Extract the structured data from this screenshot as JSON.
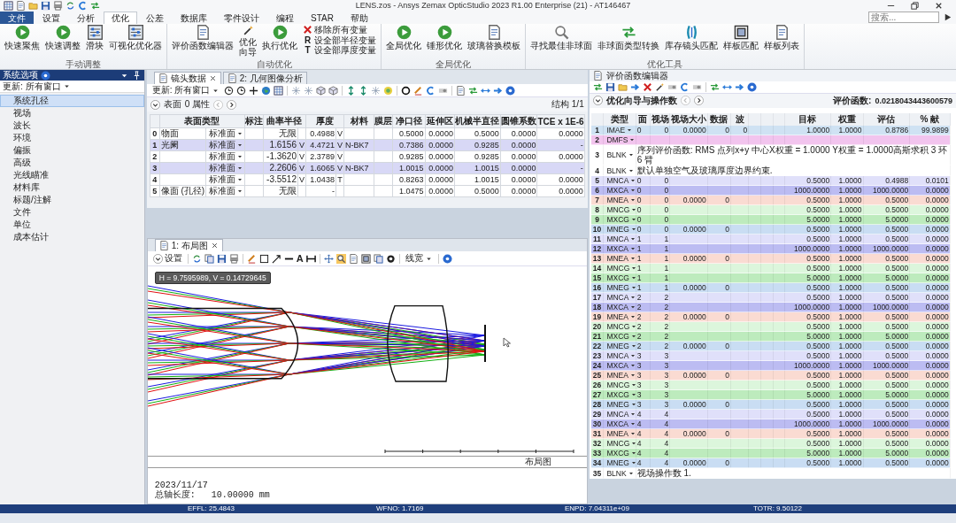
{
  "window": {
    "title": "LENS.zos - Ansys Zemax OpticStudio 2023 R1.00   Enterprise (21) - AT146467"
  },
  "menu_tabs": [
    {
      "label": "文件",
      "kind": "file",
      "selected": false
    },
    {
      "label": "设置",
      "kind": "tab",
      "selected": false
    },
    {
      "label": "分析",
      "kind": "tab",
      "selected": false
    },
    {
      "label": "优化",
      "kind": "tab",
      "selected": true
    },
    {
      "label": "公差",
      "kind": "tab",
      "selected": false
    },
    {
      "label": "数据库",
      "kind": "tab",
      "selected": false
    },
    {
      "label": "零件设计",
      "kind": "tab",
      "selected": false
    },
    {
      "label": "编程",
      "kind": "tab",
      "selected": false
    },
    {
      "label": "STAR",
      "kind": "tab",
      "selected": false
    },
    {
      "label": "帮助",
      "kind": "tab",
      "selected": false
    }
  ],
  "search": {
    "placeholder": "搜索..."
  },
  "ribbon": [
    {
      "label": "手动调整",
      "buttons": [
        {
          "label": "快速聚焦",
          "kind": "large"
        },
        {
          "label": "快速调整",
          "kind": "large"
        },
        {
          "label": "滑块",
          "kind": "large"
        },
        {
          "label": "可视化优化器",
          "kind": "large"
        }
      ]
    },
    {
      "label": "自动优化",
      "buttons": [
        {
          "label": "评价函数编辑器",
          "kind": "large"
        },
        {
          "label": "优化向导",
          "kind": "narrow"
        },
        {
          "label": "执行优化",
          "kind": "large"
        }
      ],
      "small_buttons": [
        {
          "label": "移除所有变量"
        },
        {
          "label": "设全部半径变量",
          "glyph": "R"
        },
        {
          "label": "设全部厚度变量",
          "glyph": "T"
        }
      ]
    },
    {
      "label": "全局优化",
      "buttons": [
        {
          "label": "全局优化",
          "kind": "large"
        },
        {
          "label": "锤形优化",
          "kind": "large"
        },
        {
          "label": "玻璃替换模板",
          "kind": "large"
        }
      ]
    },
    {
      "label": "优化工具",
      "buttons": [
        {
          "label": "寻找最佳非球面",
          "kind": "large"
        },
        {
          "label": "非球面类型转换",
          "kind": "large"
        },
        {
          "label": "库存镜头匹配",
          "kind": "large"
        },
        {
          "label": "样板匹配",
          "kind": "large"
        },
        {
          "label": "样板列表",
          "kind": "large"
        }
      ]
    }
  ],
  "sidebar": {
    "title": "系统选项",
    "update": "更新: 所有窗口",
    "items": [
      {
        "label": "系统孔径",
        "selected": true
      },
      {
        "label": "视场",
        "selected": false
      },
      {
        "label": "波长",
        "selected": false
      },
      {
        "label": "环境",
        "selected": false
      },
      {
        "label": "偏振",
        "selected": false
      },
      {
        "label": "高级",
        "selected": false
      },
      {
        "label": "光线瞄准",
        "selected": false
      },
      {
        "label": "材料库",
        "selected": false
      },
      {
        "label": "标题/注解",
        "selected": false
      },
      {
        "label": "文件",
        "selected": false
      },
      {
        "label": "单位",
        "selected": false
      },
      {
        "label": "成本估计",
        "selected": false
      }
    ]
  },
  "lens_pane": {
    "tabs": [
      {
        "label": "镜头数据",
        "selected": true
      },
      {
        "label": "2: 几何图像分析",
        "selected": false
      }
    ],
    "update": "更新: 所有窗口",
    "surface_label": "表面",
    "surface_props": "0 属性",
    "config": "结构 1/1",
    "columns": [
      "表面类型",
      "标注",
      "曲率半径",
      "厚度",
      "材料",
      "膜层",
      "净口径",
      "延伸区",
      "机械半直径",
      "圆锥系数",
      "TCE x 1E-6"
    ],
    "rows": [
      {
        "num": "0",
        "comment": "物面",
        "type": "标准面",
        "radius": "无限",
        "thickness": "0.4988",
        "thickness_solve": "V",
        "clear": "0.5000",
        "chip": "0.0000",
        "mech": "0.5000",
        "conic": "0.0000",
        "tce": "0.0000",
        "color": "#ffffff"
      },
      {
        "num": "1",
        "comment": "光阑",
        "type": "标准面",
        "radius": "1.6156",
        "radius_solve": "V",
        "thickness": "4.4721",
        "thickness_solve": "V",
        "material": "N-BK7",
        "clear": "0.7386",
        "chip": "0.0000",
        "mech": "0.9285",
        "conic": "0.0000",
        "tce": "-",
        "color": "#d8d8f6"
      },
      {
        "num": "2",
        "type": "标准面",
        "radius": "-1.3620",
        "radius_solve": "V",
        "thickness": "2.3789",
        "thickness_solve": "V",
        "clear": "0.9285",
        "chip": "0.0000",
        "mech": "0.9285",
        "conic": "0.0000",
        "tce": "0.0000",
        "color": "#ffffff"
      },
      {
        "num": "3",
        "type": "标准面",
        "radius": "2.2606",
        "radius_solve": "V",
        "thickness": "1.6065",
        "thickness_solve": "V",
        "material": "N-BK7",
        "clear": "1.0015",
        "chip": "0.0000",
        "mech": "1.0015",
        "conic": "0.0000",
        "tce": "-",
        "color": "#d8d8f6"
      },
      {
        "num": "4",
        "type": "标准面",
        "radius": "-3.5512",
        "radius_solve": "V",
        "thickness": "1.0438",
        "thickness_solve": "T",
        "clear": "0.8263",
        "chip": "0.0000",
        "mech": "1.0015",
        "conic": "0.0000",
        "tce": "0.0000",
        "color": "#ffffff"
      },
      {
        "num": "5",
        "comment": "像面 (孔径)",
        "type": "标准面",
        "radius": "无限",
        "thickness": "-",
        "clear": "1.0475",
        "chip": "0.0000",
        "mech": "0.5000",
        "conic": "0.0000",
        "tce": "0.0000",
        "color": "#ffffff"
      }
    ]
  },
  "layout_pane": {
    "tab": {
      "label": "1: 布局图",
      "selected": true
    },
    "settings": "设置",
    "text_tool": "A",
    "line_width": "线宽",
    "tooltip": "H = 9.7595989, V = 0.14729645",
    "caption": "布局图",
    "footer": [
      "2023/11/17",
      "总轴长度:   10.00000 mm"
    ]
  },
  "merit_pane": {
    "title": "评价函数编辑器",
    "section": "优化向导与操作数",
    "merit_label": "评价函数:",
    "merit_value": "0.0218043443600579",
    "columns": [
      "类型",
      "面",
      "视场",
      "视场大小",
      "数据",
      "波",
      "目标",
      "权重",
      "评估",
      "% 献"
    ],
    "rows": [
      {
        "num": "1",
        "type": "IMAE",
        "surf": "0",
        "field": "0",
        "field_size": "0.0000",
        "data": "0",
        "wave": "0",
        "target": "1.0000",
        "weight": "1.0000",
        "value": "0.8786",
        "contrib": "99.9899",
        "color": "#cfe2f3"
      },
      {
        "num": "2",
        "type": "DMFS",
        "color": "#f2c4ee"
      },
      {
        "num": "3",
        "type": "BLNK",
        "comment": "序列评价函数: RMS 点列x+y 中心X权重 = 1.0000 Y权重 = 1.0000高斯求积 3 环 6 臂",
        "color": "#ffffff"
      },
      {
        "num": "4",
        "type": "BLNK",
        "comment": "默认单独空气及玻璃厚度边界约束.",
        "color": "#ffffff"
      },
      {
        "num": "5",
        "type": "MNCA",
        "surf": "0",
        "field": "0",
        "target": "0.5000",
        "weight": "1.0000",
        "value": "0.4988",
        "contrib": "0.0101",
        "color": "#e0e0fa"
      },
      {
        "num": "6",
        "type": "MXCA",
        "surf": "0",
        "field": "0",
        "target": "1000.0000",
        "weight": "1.0000",
        "value": "1000.0000",
        "contrib": "0.0000",
        "color": "#bcbcf2"
      },
      {
        "num": "7",
        "type": "MNEA",
        "surf": "0",
        "field": "0",
        "field_size": "0.0000",
        "data": "0",
        "target": "0.5000",
        "weight": "1.0000",
        "value": "0.5000",
        "contrib": "0.0000",
        "color": "#fadbd2"
      },
      {
        "num": "8",
        "type": "MNCG",
        "surf": "0",
        "field": "0",
        "target": "0.5000",
        "weight": "1.0000",
        "value": "0.5000",
        "contrib": "0.0000",
        "color": "#dcf6dc"
      },
      {
        "num": "9",
        "type": "MXCG",
        "surf": "0",
        "field": "0",
        "target": "5.0000",
        "weight": "1.0000",
        "value": "5.0000",
        "contrib": "0.0000",
        "color": "#bdebbd"
      },
      {
        "num": "10",
        "type": "MNEG",
        "surf": "0",
        "field": "0",
        "field_size": "0.0000",
        "data": "0",
        "target": "0.5000",
        "weight": "1.0000",
        "value": "0.5000",
        "contrib": "0.0000",
        "color": "#c9ddf3"
      },
      {
        "num": "11",
        "type": "MNCA",
        "surf": "1",
        "field": "1",
        "target": "0.5000",
        "weight": "1.0000",
        "value": "0.5000",
        "contrib": "0.0000",
        "color": "#e0e0fa"
      },
      {
        "num": "12",
        "type": "MXCA",
        "surf": "1",
        "field": "1",
        "target": "1000.0000",
        "weight": "1.0000",
        "value": "1000.0000",
        "contrib": "0.0000",
        "color": "#bcbcf2"
      },
      {
        "num": "13",
        "type": "MNEA",
        "surf": "1",
        "field": "1",
        "field_size": "0.0000",
        "data": "0",
        "target": "0.5000",
        "weight": "1.0000",
        "value": "0.5000",
        "contrib": "0.0000",
        "color": "#fadbd2"
      },
      {
        "num": "14",
        "type": "MNCG",
        "surf": "1",
        "field": "1",
        "target": "0.5000",
        "weight": "1.0000",
        "value": "0.5000",
        "contrib": "0.0000",
        "color": "#dcf6dc"
      },
      {
        "num": "15",
        "type": "MXCG",
        "surf": "1",
        "field": "1",
        "target": "5.0000",
        "weight": "1.0000",
        "value": "5.0000",
        "contrib": "0.0000",
        "color": "#bdebbd"
      },
      {
        "num": "16",
        "type": "MNEG",
        "surf": "1",
        "field": "1",
        "field_size": "0.0000",
        "data": "0",
        "target": "0.5000",
        "weight": "1.0000",
        "value": "0.5000",
        "contrib": "0.0000",
        "color": "#c9ddf3"
      },
      {
        "num": "17",
        "type": "MNCA",
        "surf": "2",
        "field": "2",
        "target": "0.5000",
        "weight": "1.0000",
        "value": "0.5000",
        "contrib": "0.0000",
        "color": "#e0e0fa"
      },
      {
        "num": "18",
        "type": "MXCA",
        "surf": "2",
        "field": "2",
        "target": "1000.0000",
        "weight": "1.0000",
        "value": "1000.0000",
        "contrib": "0.0000",
        "color": "#bcbcf2"
      },
      {
        "num": "19",
        "type": "MNEA",
        "surf": "2",
        "field": "2",
        "field_size": "0.0000",
        "data": "0",
        "target": "0.5000",
        "weight": "1.0000",
        "value": "0.5000",
        "contrib": "0.0000",
        "color": "#fadbd2"
      },
      {
        "num": "20",
        "type": "MNCG",
        "surf": "2",
        "field": "2",
        "target": "0.5000",
        "weight": "1.0000",
        "value": "0.5000",
        "contrib": "0.0000",
        "color": "#dcf6dc"
      },
      {
        "num": "21",
        "type": "MXCG",
        "surf": "2",
        "field": "2",
        "target": "5.0000",
        "weight": "1.0000",
        "value": "5.0000",
        "contrib": "0.0000",
        "color": "#bdebbd"
      },
      {
        "num": "22",
        "type": "MNEG",
        "surf": "2",
        "field": "2",
        "field_size": "0.0000",
        "data": "0",
        "target": "0.5000",
        "weight": "1.0000",
        "value": "0.5000",
        "contrib": "0.0000",
        "color": "#c9ddf3"
      },
      {
        "num": "23",
        "type": "MNCA",
        "surf": "3",
        "field": "3",
        "target": "0.5000",
        "weight": "1.0000",
        "value": "0.5000",
        "contrib": "0.0000",
        "color": "#e0e0fa"
      },
      {
        "num": "24",
        "type": "MXCA",
        "surf": "3",
        "field": "3",
        "target": "1000.0000",
        "weight": "1.0000",
        "value": "1000.0000",
        "contrib": "0.0000",
        "color": "#bcbcf2"
      },
      {
        "num": "25",
        "type": "MNEA",
        "surf": "3",
        "field": "3",
        "field_size": "0.0000",
        "data": "0",
        "target": "0.5000",
        "weight": "1.0000",
        "value": "0.5000",
        "contrib": "0.0000",
        "color": "#fadbd2"
      },
      {
        "num": "26",
        "type": "MNCG",
        "surf": "3",
        "field": "3",
        "target": "0.5000",
        "weight": "1.0000",
        "value": "0.5000",
        "contrib": "0.0000",
        "color": "#dcf6dc"
      },
      {
        "num": "27",
        "type": "MXCG",
        "surf": "3",
        "field": "3",
        "target": "5.0000",
        "weight": "1.0000",
        "value": "5.0000",
        "contrib": "0.0000",
        "color": "#bdebbd"
      },
      {
        "num": "28",
        "type": "MNEG",
        "surf": "3",
        "field": "3",
        "field_size": "0.0000",
        "data": "0",
        "target": "0.5000",
        "weight": "1.0000",
        "value": "0.5000",
        "contrib": "0.0000",
        "color": "#c9ddf3"
      },
      {
        "num": "29",
        "type": "MNCA",
        "surf": "4",
        "field": "4",
        "target": "0.5000",
        "weight": "1.0000",
        "value": "0.5000",
        "contrib": "0.0000",
        "color": "#e0e0fa"
      },
      {
        "num": "30",
        "type": "MXCA",
        "surf": "4",
        "field": "4",
        "target": "1000.0000",
        "weight": "1.0000",
        "value": "1000.0000",
        "contrib": "0.0000",
        "color": "#bcbcf2"
      },
      {
        "num": "31",
        "type": "MNEA",
        "surf": "4",
        "field": "4",
        "field_size": "0.0000",
        "data": "0",
        "target": "0.5000",
        "weight": "1.0000",
        "value": "0.5000",
        "contrib": "0.0000",
        "color": "#fadbd2"
      },
      {
        "num": "32",
        "type": "MNCG",
        "surf": "4",
        "field": "4",
        "target": "0.5000",
        "weight": "1.0000",
        "value": "0.5000",
        "contrib": "0.0000",
        "color": "#dcf6dc"
      },
      {
        "num": "33",
        "type": "MXCG",
        "surf": "4",
        "field": "4",
        "target": "5.0000",
        "weight": "1.0000",
        "value": "5.0000",
        "contrib": "0.0000",
        "color": "#bdebbd"
      },
      {
        "num": "34",
        "type": "MNEG",
        "surf": "4",
        "field": "4",
        "field_size": "0.0000",
        "data": "0",
        "target": "0.5000",
        "weight": "1.0000",
        "value": "0.5000",
        "contrib": "0.0000",
        "color": "#c9ddf3"
      },
      {
        "num": "35",
        "type": "BLNK",
        "comment": "视场操作数 1.",
        "color": "#ffffff"
      }
    ]
  },
  "status_bar": [
    "EFFL: 25.4843",
    "WFNO: 1.7169",
    "ENPD: 7.04311e+09",
    "TOTR: 9.50122"
  ]
}
